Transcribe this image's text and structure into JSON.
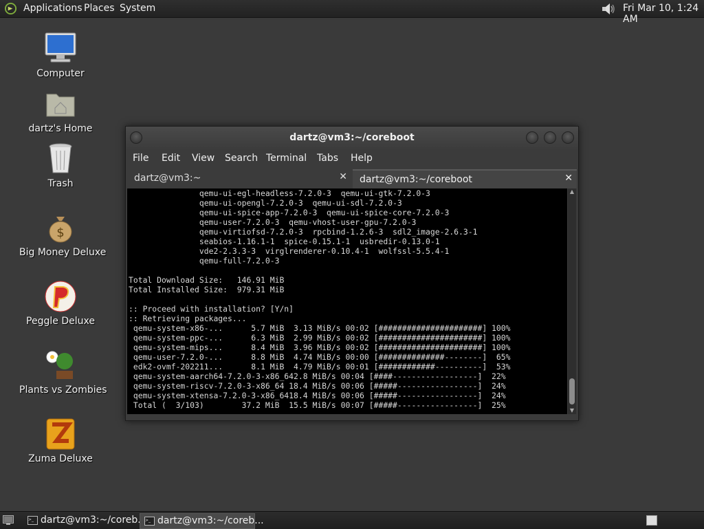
{
  "top_panel": {
    "menus": [
      "Applications",
      "Places",
      "System"
    ],
    "clock": "Fri Mar 10,  1:24 AM",
    "icons": [
      "gnome-foot-logo",
      "volume-icon"
    ]
  },
  "desktop_icons": [
    {
      "label": "Computer",
      "icon": "computer-icon"
    },
    {
      "label": "dartz's Home",
      "icon": "home-folder-icon"
    },
    {
      "label": "Trash",
      "icon": "trash-icon"
    },
    {
      "label": "Big Money Deluxe",
      "icon": "money-bag-icon"
    },
    {
      "label": "Peggle Deluxe",
      "icon": "peggle-icon"
    },
    {
      "label": "Plants vs Zombies",
      "icon": "plant-icon"
    },
    {
      "label": "Zuma Deluxe",
      "icon": "zuma-icon"
    }
  ],
  "terminal": {
    "title": "dartz@vm3:~/coreboot",
    "menu": [
      "File",
      "Edit",
      "View",
      "Search",
      "Terminal",
      "Tabs",
      "Help"
    ],
    "tabs": [
      {
        "label": "dartz@vm3:~",
        "active": false
      },
      {
        "label": "dartz@vm3:~/coreboot",
        "active": true
      }
    ],
    "lines": [
      "               qemu-ui-egl-headless-7.2.0-3  qemu-ui-gtk-7.2.0-3",
      "               qemu-ui-opengl-7.2.0-3  qemu-ui-sdl-7.2.0-3",
      "               qemu-ui-spice-app-7.2.0-3  qemu-ui-spice-core-7.2.0-3",
      "               qemu-user-7.2.0-3  qemu-vhost-user-gpu-7.2.0-3",
      "               qemu-virtiofsd-7.2.0-3  rpcbind-1.2.6-3  sdl2_image-2.6.3-1",
      "               seabios-1.16.1-1  spice-0.15.1-1  usbredir-0.13.0-1",
      "               vde2-2.3.3-3  virglrenderer-0.10.4-1  wolfssl-5.5.4-1",
      "               qemu-full-7.2.0-3",
      "",
      "Total Download Size:   146.91 MiB",
      "Total Installed Size:  979.31 MiB",
      "",
      ":: Proceed with installation? [Y/n]",
      ":: Retrieving packages...",
      " qemu-system-x86-...      5.7 MiB  3.13 MiB/s 00:02 [######################] 100%",
      " qemu-system-ppc-...      6.3 MiB  2.99 MiB/s 00:02 [######################] 100%",
      " qemu-system-mips...      8.4 MiB  3.96 MiB/s 00:02 [######################] 100%",
      " qemu-user-7.2.0-...      8.8 MiB  4.74 MiB/s 00:00 [##############--------]  65%",
      " edk2-ovmf-202211...      8.1 MiB  4.79 MiB/s 00:01 [############----------]  53%",
      " qemu-system-aarch64-7.2.0-3-x86_642.8 MiB/s 00:04 [####------------------]  22%",
      " qemu-system-riscv-7.2.0-3-x86_64 18.4 MiB/s 00:06 [#####-----------------]  24%",
      " qemu-system-xtensa-7.2.0-3-x86_6418.4 MiB/s 00:06 [#####-----------------]  24%",
      " Total (  3/103)        37.2 MiB  15.5 MiB/s 00:07 [#####-----------------]  25%"
    ]
  },
  "taskbar": {
    "items": [
      {
        "label": "dartz@vm3:~/coreb...",
        "active": false
      },
      {
        "label": "dartz@vm3:~/coreb...",
        "active": true
      }
    ]
  }
}
